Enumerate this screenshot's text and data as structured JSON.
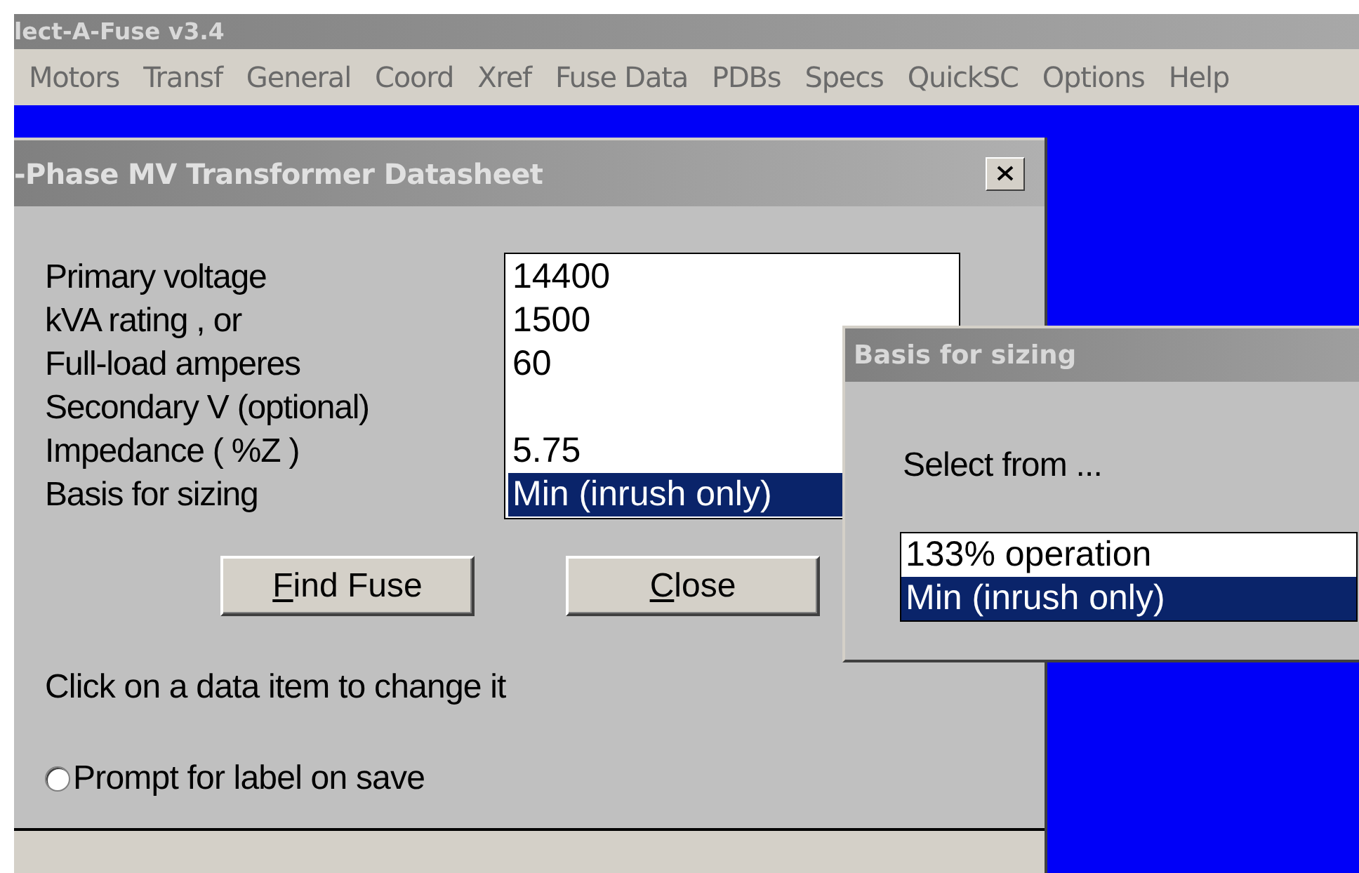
{
  "app": {
    "title": "lect-A-Fuse v3.4",
    "menu": [
      "Motors",
      "Transf",
      "General",
      "Coord",
      "Xref",
      "Fuse Data",
      "PDBs",
      "Specs",
      "QuickSC",
      "Options",
      "Help"
    ]
  },
  "dialog": {
    "title": "-Phase MV Transformer Datasheet",
    "fields": [
      {
        "label": "Primary voltage",
        "value": "14400",
        "selected": false
      },
      {
        "label": "kVA rating , or",
        "value": "1500",
        "selected": false
      },
      {
        "label": "Full-load amperes",
        "value": "60",
        "selected": false
      },
      {
        "label": "Secondary V (optional)",
        "selected": false
      },
      {
        "label": "Impedance ( %Z )",
        "value": "5.75",
        "selected": false
      },
      {
        "label": "Basis for sizing",
        "value": "Min (inrush only)",
        "selected": true
      }
    ],
    "buttons": [
      {
        "underlined": "F",
        "rest": "ind Fuse"
      },
      {
        "underlined": "C",
        "rest": "lose"
      }
    ],
    "hint": "Click on a data item to change it",
    "option": {
      "label": "Prompt for label on save",
      "checked": false
    }
  },
  "popup": {
    "title": "Basis for sizing",
    "prompt": "Select from ...",
    "options": [
      {
        "label": "133% operation",
        "selected": false
      },
      {
        "label": "Min (inrush only)",
        "selected": true
      }
    ]
  }
}
